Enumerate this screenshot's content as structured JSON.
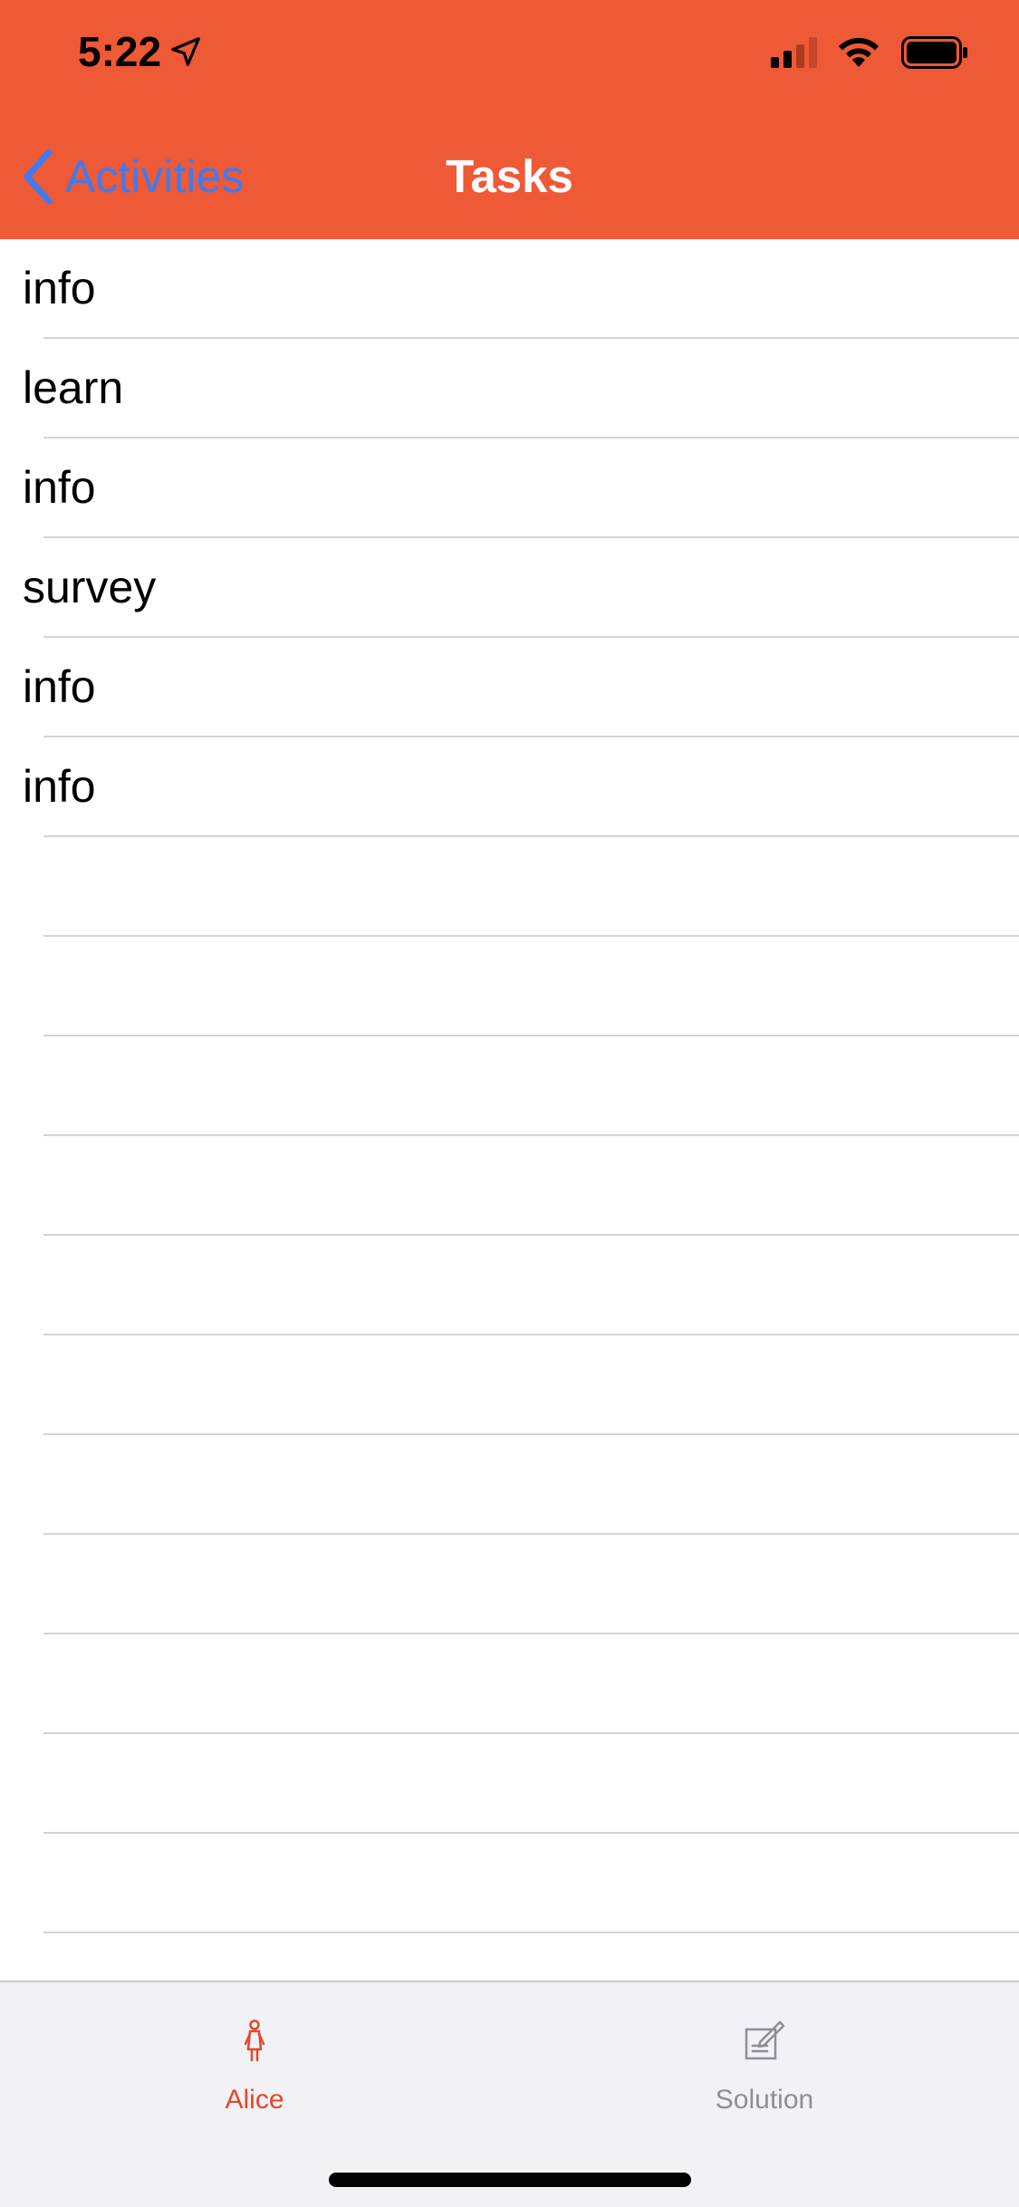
{
  "status_bar": {
    "time": "5:22"
  },
  "nav": {
    "back_label": "Activities",
    "title": "Tasks"
  },
  "tasks": [
    "info",
    "learn",
    "info",
    "survey",
    "info",
    "info"
  ],
  "tab_bar": {
    "tabs": [
      {
        "label": "Alice",
        "icon": "person-icon",
        "selected": true
      },
      {
        "label": "Solution",
        "icon": "compose-icon",
        "selected": false
      }
    ]
  },
  "colors": {
    "header_bg": "#EE5936",
    "back_link": "#3F7BF0",
    "tab_selected": "#E8452A",
    "tab_unselected": "#8E8E93"
  }
}
